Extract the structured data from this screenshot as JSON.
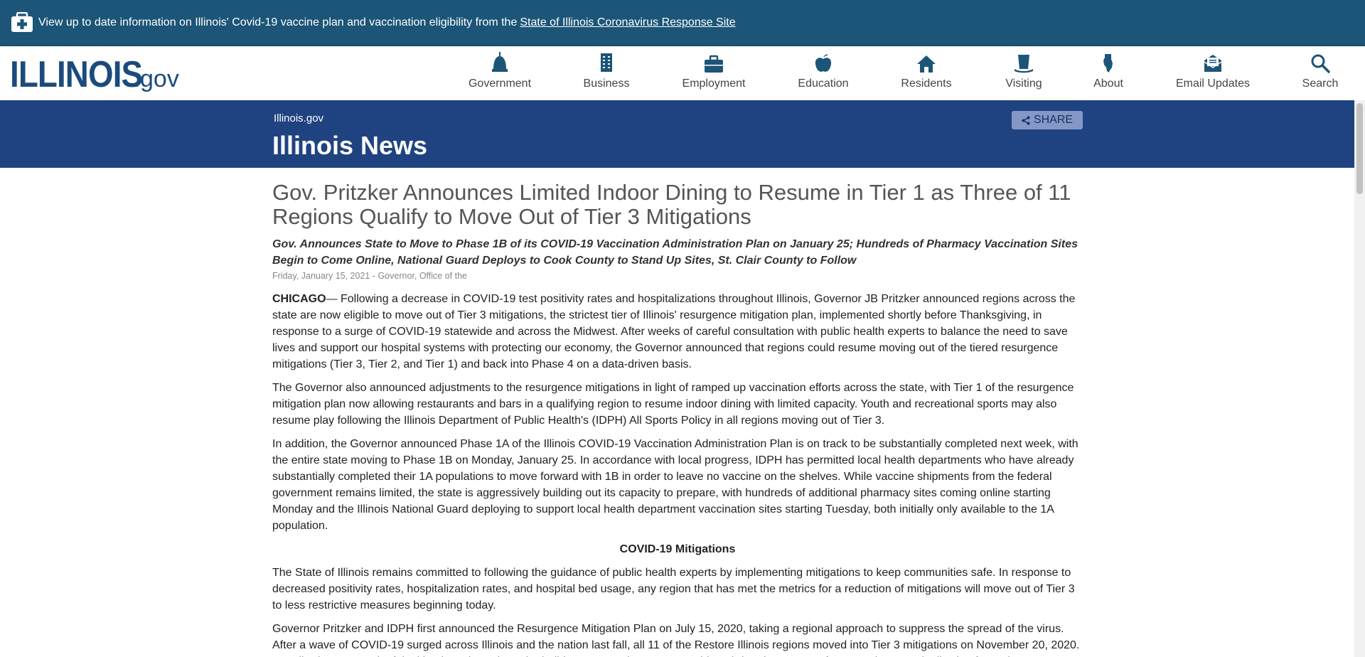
{
  "alert": {
    "text": "View up to date information on Illinois' Covid-19 vaccine plan and vaccination eligibility from the",
    "link": "State of Illinois Coronavirus Response Site",
    "icon": "first-aid-kit-icon"
  },
  "header": {
    "logo_main": "ILLINOIS",
    "logo_suffix": ".gov",
    "nav": [
      {
        "label": "Government",
        "icon": "capitol-dome-icon"
      },
      {
        "label": "Business",
        "icon": "building-icon"
      },
      {
        "label": "Employment",
        "icon": "briefcase-icon"
      },
      {
        "label": "Education",
        "icon": "apple-icon"
      },
      {
        "label": "Residents",
        "icon": "house-icon"
      },
      {
        "label": "Visiting",
        "icon": "hat-icon"
      },
      {
        "label": "About",
        "icon": "illinois-map-icon"
      },
      {
        "label": "Email Updates",
        "icon": "envelope-icon"
      },
      {
        "label": "Search",
        "icon": "search-icon"
      }
    ]
  },
  "band": {
    "breadcrumb": "Illinois.gov",
    "title": "Illinois News",
    "share_label": "SHARE"
  },
  "article": {
    "headline": "Gov. Pritzker Announces Limited Indoor Dining to Resume in Tier 1 as Three of 11 Regions Qualify to Move Out of Tier 3 Mitigations",
    "subhead": "Gov. Announces State to Move to Phase 1B of its COVID-19 Vaccination Administration Plan on January 25; Hundreds of Pharmacy Vaccination Sites Begin to Come Online, National Guard Deploys to Cook County to Stand Up Sites, St. Clair County to Follow",
    "dateline": "Friday, January 15, 2021 - Governor, Office of the",
    "lead_dateline": "CHICAGO",
    "p1": "— Following a decrease in COVID-19 test positivity rates and hospitalizations throughout Illinois, Governor JB Pritzker announced regions across the state are now eligible to move out of Tier 3 mitigations, the strictest tier of Illinois' resurgence mitigation plan, implemented shortly before Thanksgiving, in response to a surge of COVID-19 statewide and across the Midwest. After weeks of careful consultation with public health experts to balance the need to save lives and support our hospital systems with protecting our economy, the Governor announced that regions could resume moving out of the tiered resurgence mitigations (Tier 3, Tier 2, and Tier 1) and back into Phase 4 on a data-driven basis.",
    "p2": "The Governor also announced adjustments to the resurgence mitigations in light of ramped up vaccination efforts across the state, with Tier 1 of the resurgence mitigation plan now allowing restaurants and bars in a qualifying region to resume indoor dining with limited capacity. Youth and recreational sports may also resume play following the Illinois Department of Public Health's (IDPH) All Sports Policy in all regions moving out of Tier 3.",
    "p3": "In addition, the Governor announced Phase 1A of the Illinois COVID-19 Vaccination Administration Plan is on track to be substantially completed next week, with the entire state moving to Phase 1B on Monday, January 25. In accordance with local progress, IDPH has permitted local health departments who have already substantially completed their 1A populations to move forward with 1B in order to leave no vaccine on the shelves. While vaccine shipments from the federal government remains limited, the state is aggressively building out its capacity to prepare, with hundreds of additional pharmacy sites coming online starting Monday and the Illinois National Guard deploying to support local health department vaccination sites starting Tuesday, both initially only available to the 1A population.",
    "section_heading": "COVID-19 Mitigations",
    "p4": "The State of Illinois remains committed to following the guidance of public health experts by implementing mitigations to keep communities safe. In response to decreased positivity rates, hospitalization rates, and hospital bed usage, any region that has met the metrics for a reduction of mitigations will move out of Tier 3 to less restrictive measures beginning today.",
    "p5": "Governor Pritzker and IDPH first announced the Resurgence Mitigation Plan on July 15, 2020, taking a regional approach to suppress the spread of the virus. After a wave of COVID-19 surged across Illinois and the nation last fall, all 11 of the Restore Illinois regions moved into Tier 3 mitigations on November 20, 2020. By adhering to meaningful mitigations throughout the holiday season, the state was able to bring down rates of community spread, allowing for regions to once"
  },
  "colors": {
    "alert_bg": "#1c5577",
    "band_bg": "#1f4381",
    "nav_icon": "#1c5577",
    "share_bg": "#8497c6"
  }
}
